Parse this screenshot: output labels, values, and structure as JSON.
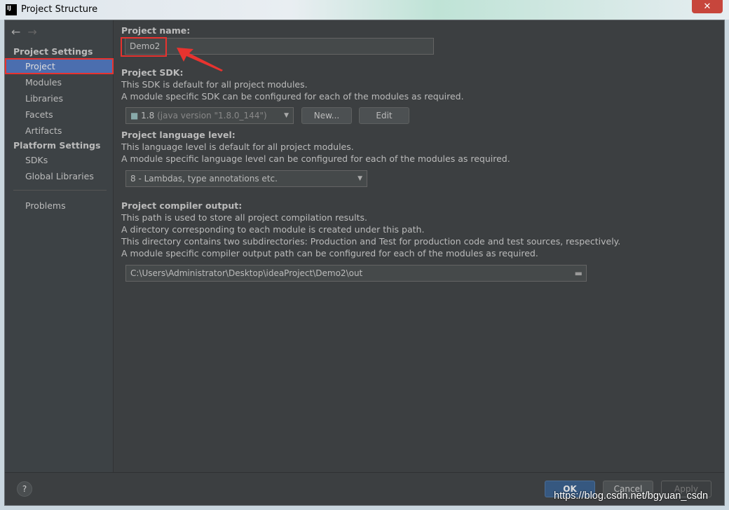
{
  "window": {
    "title": "Project Structure",
    "app_icon": "IJ",
    "close": "✕"
  },
  "sidebar": {
    "back": "←",
    "forward": "→",
    "project_settings": "Project Settings",
    "platform_settings": "Platform Settings",
    "items": [
      {
        "label": "Project"
      },
      {
        "label": "Modules"
      },
      {
        "label": "Libraries"
      },
      {
        "label": "Facets"
      },
      {
        "label": "Artifacts"
      },
      {
        "label": "SDKs"
      },
      {
        "label": "Global Libraries"
      },
      {
        "label": "Problems"
      }
    ]
  },
  "main": {
    "name_label": "Project name:",
    "name_value": "Demo2",
    "sdk_label": "Project SDK:",
    "sdk_desc1": "This SDK is default for all project modules.",
    "sdk_desc2": "A module specific SDK can be configured for each of the modules as required.",
    "sdk_value": "1.8",
    "sdk_detail": "(java version \"1.8.0_144\")",
    "new_button": "New...",
    "edit_button": "Edit",
    "lang_label": "Project language level:",
    "lang_desc1": "This language level is default for all project modules.",
    "lang_desc2": "A module specific language level can be configured for each of the modules as required.",
    "lang_value": "8 - Lambdas, type annotations etc.",
    "out_label": "Project compiler output:",
    "out_desc1": "This path is used to store all project compilation results.",
    "out_desc2": "A directory corresponding to each module is created under this path.",
    "out_desc3": "This directory contains two subdirectories: Production and Test for production code and test sources, respectively.",
    "out_desc4": "A module specific compiler output path can be configured for each of the modules as required.",
    "out_value": "C:\\Users\\Administrator\\Desktop\\ideaProject\\Demo2\\out"
  },
  "footer": {
    "help": "?",
    "ok": "OK",
    "cancel": "Cancel",
    "apply": "Apply"
  },
  "watermark": "https://blog.csdn.net/bgyuan_csdn",
  "colors": {
    "selection": "#4b6eaf",
    "highlight": "#e8332f",
    "ok": "#365880"
  }
}
